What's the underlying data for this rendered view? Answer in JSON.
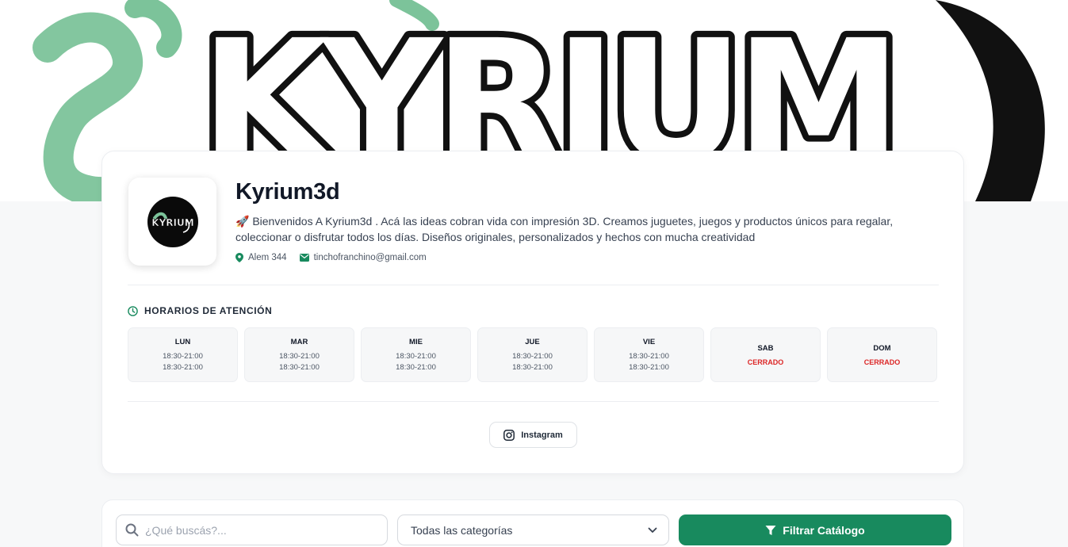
{
  "banner": {
    "wordmark": "KYRIUM"
  },
  "store": {
    "name": "Kyrium3d",
    "description": "🚀 Bienvenidos A Kyrium3d . Acá las ideas cobran vida con impresión 3D. Creamos juguetes, juegos y productos únicos para regalar, coleccionar o disfrutar todos los días. Diseños originales, personalizados y hechos con mucha creatividad",
    "logo_text": "KYRIUM",
    "address": "Alem 344",
    "email": "tinchofranchino@gmail.com"
  },
  "hours": {
    "title": "HORARIOS DE ATENCIÓN",
    "days": [
      {
        "day": "LUN",
        "slot1": "18:30-21:00",
        "slot2": "18:30-21:00"
      },
      {
        "day": "MAR",
        "slot1": "18:30-21:00",
        "slot2": "18:30-21:00"
      },
      {
        "day": "MIE",
        "slot1": "18:30-21:00",
        "slot2": "18:30-21:00"
      },
      {
        "day": "JUE",
        "slot1": "18:30-21:00",
        "slot2": "18:30-21:00"
      },
      {
        "day": "VIE",
        "slot1": "18:30-21:00",
        "slot2": "18:30-21:00"
      },
      {
        "day": "SAB",
        "closed": "CERRADO"
      },
      {
        "day": "DOM",
        "closed": "CERRADO"
      }
    ]
  },
  "social": {
    "instagram_label": "Instagram"
  },
  "filters": {
    "search_placeholder": "¿Qué buscás?...",
    "category_selected": "Todas las categorías",
    "filter_button": "Filtrar Catálogo"
  },
  "colors": {
    "accent": "#188a5e",
    "closed": "#dc2626",
    "banner_green": "#7cc39a"
  }
}
